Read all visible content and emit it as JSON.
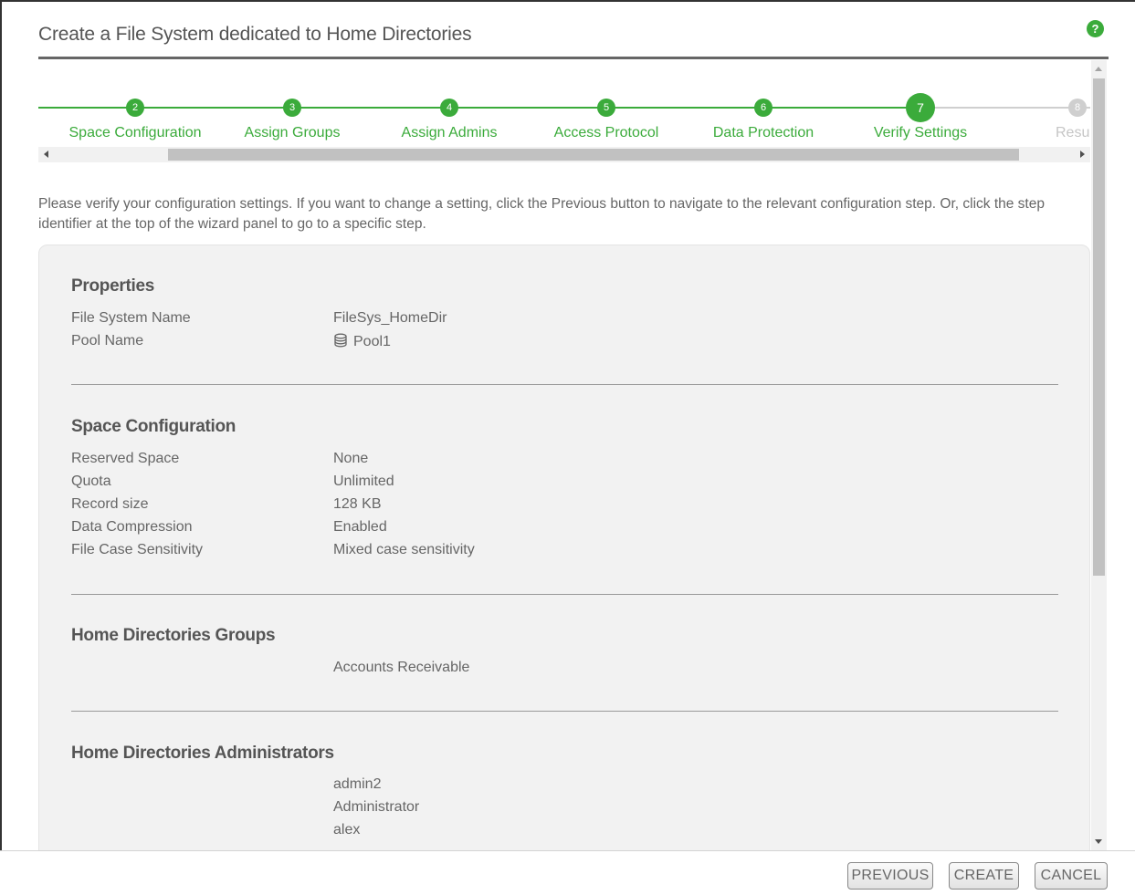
{
  "header": {
    "title": "Create a File System dedicated to Home Directories",
    "help_icon": "question-mark-icon",
    "help_glyph": "?"
  },
  "stepper": {
    "steps": [
      {
        "number": "2",
        "label": "Space Configuration",
        "state": "done"
      },
      {
        "number": "3",
        "label": "Assign Groups",
        "state": "done"
      },
      {
        "number": "4",
        "label": "Assign Admins",
        "state": "done"
      },
      {
        "number": "5",
        "label": "Access Protocol",
        "state": "done"
      },
      {
        "number": "6",
        "label": "Data Protection",
        "state": "done"
      },
      {
        "number": "7",
        "label": "Verify Settings",
        "state": "current"
      },
      {
        "number": "8",
        "label": "Resul",
        "state": "pending"
      }
    ],
    "accent_color": "#3bab3b",
    "inactive_color": "#cfcfcf"
  },
  "intro_text": "Please verify your configuration settings. If you want to change a setting, click the Previous button to navigate to the relevant configuration step. Or, click the step identifier at the top of the wizard panel to go to a specific step.",
  "properties": {
    "title": "Properties",
    "file_system_name_label": "File System Name",
    "file_system_name_value": "FileSys_HomeDir",
    "pool_name_label": "Pool Name",
    "pool_name_value": "Pool1",
    "pool_icon": "database-icon"
  },
  "space_configuration": {
    "title": "Space Configuration",
    "rows": [
      {
        "label": "Reserved Space",
        "value": "None"
      },
      {
        "label": "Quota",
        "value": "Unlimited"
      },
      {
        "label": "Record size",
        "value": "128 KB"
      },
      {
        "label": "Data Compression",
        "value": "Enabled"
      },
      {
        "label": "File Case Sensitivity",
        "value": "Mixed case sensitivity"
      }
    ]
  },
  "home_directories_groups": {
    "title": "Home Directories Groups",
    "items": [
      "Accounts Receivable"
    ]
  },
  "home_directories_administrators": {
    "title": "Home Directories Administrators",
    "items": [
      "admin2",
      "Administrator",
      "alex"
    ]
  },
  "footer": {
    "previous_label": "PREVIOUS",
    "create_label": "CREATE",
    "cancel_label": "CANCEL"
  }
}
